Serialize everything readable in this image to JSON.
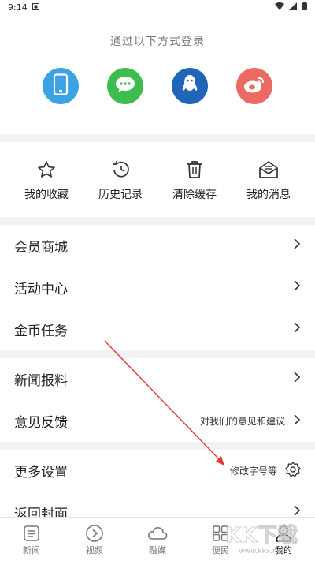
{
  "status_bar": {
    "time": "9:14"
  },
  "login": {
    "title": "通过以下方式登录",
    "methods": [
      {
        "icon": "phone-icon",
        "color": "#3aa3e3"
      },
      {
        "icon": "wechat-icon",
        "color": "#3ebd4f"
      },
      {
        "icon": "qq-icon",
        "color": "#1f66b8"
      },
      {
        "icon": "weibo-icon",
        "color": "#ec6a62"
      }
    ]
  },
  "quick_actions": [
    {
      "label": "我的收藏",
      "icon": "star-icon"
    },
    {
      "label": "历史记录",
      "icon": "history-icon"
    },
    {
      "label": "清除缓存",
      "icon": "trash-icon"
    },
    {
      "label": "我的消息",
      "icon": "message-icon"
    }
  ],
  "menu": {
    "member_mall": "会员商城",
    "activity_center": "活动中心",
    "coin_tasks": "金币任务",
    "news_tips": "新闻报料",
    "feedback": "意见反馈",
    "feedback_hint": "对我们的意见和建议",
    "more_settings": "更多设置",
    "settings_hint": "修改字号等",
    "return_cover": "返回封面"
  },
  "tabbar": [
    {
      "label": "新闻",
      "icon": "news-icon"
    },
    {
      "label": "视频",
      "icon": "video-icon"
    },
    {
      "label": "融媒",
      "icon": "cloud-icon"
    },
    {
      "label": "便民",
      "icon": "grid-icon"
    },
    {
      "label": "我的",
      "icon": "user-icon",
      "active": true
    }
  ],
  "watermark": {
    "text": "KK下载",
    "url": "www.kkx.net"
  },
  "colors": {
    "arrow": "#e53935"
  }
}
